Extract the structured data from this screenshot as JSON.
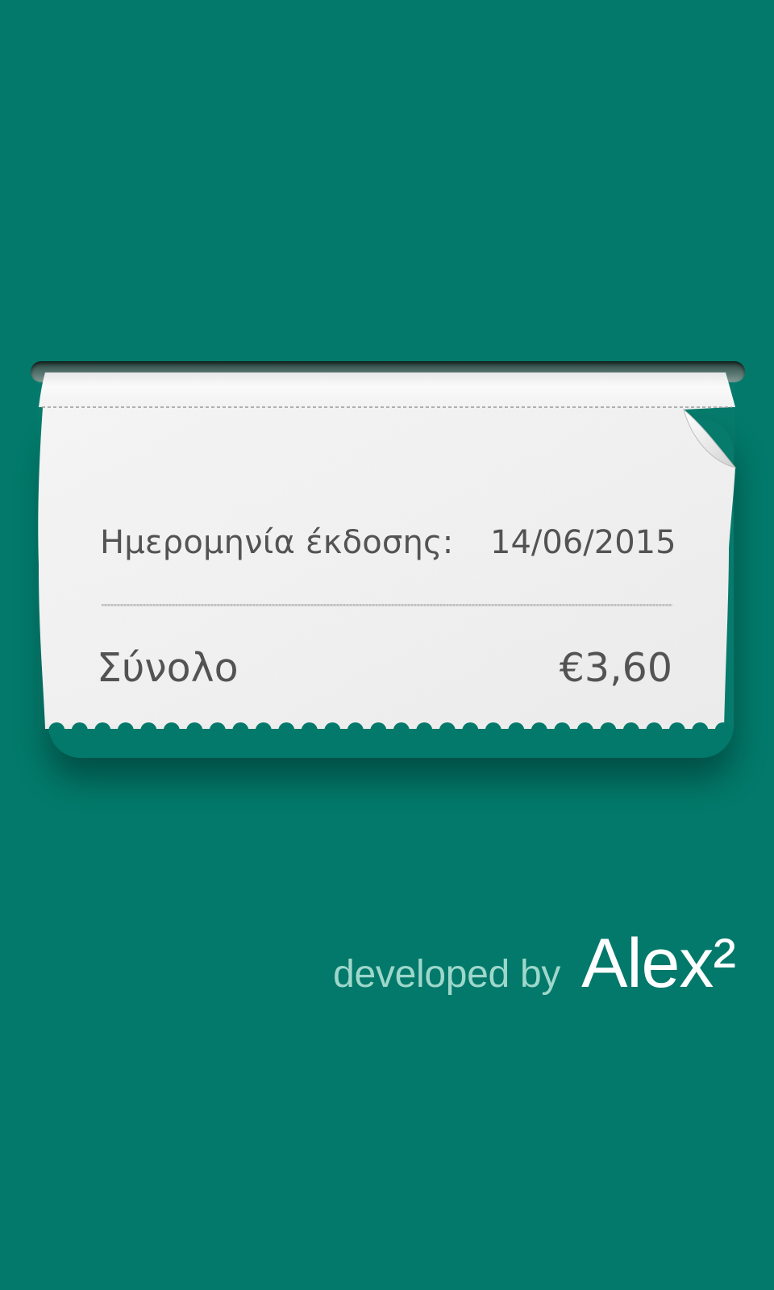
{
  "receipt": {
    "issue_label": "Ημερομηνία έκδοσης:",
    "issue_date": "14/06/2015",
    "total_label": "Σύνολο",
    "total_amount": "€3,60"
  },
  "credit": {
    "prefix": "developed by",
    "brand": "Alex²"
  },
  "colors": {
    "background": "#02796a",
    "paper": "#f3f3f3",
    "receipt_text": "#535353",
    "credit_prefix": "#9ed7cb",
    "brand": "#ffffff"
  }
}
